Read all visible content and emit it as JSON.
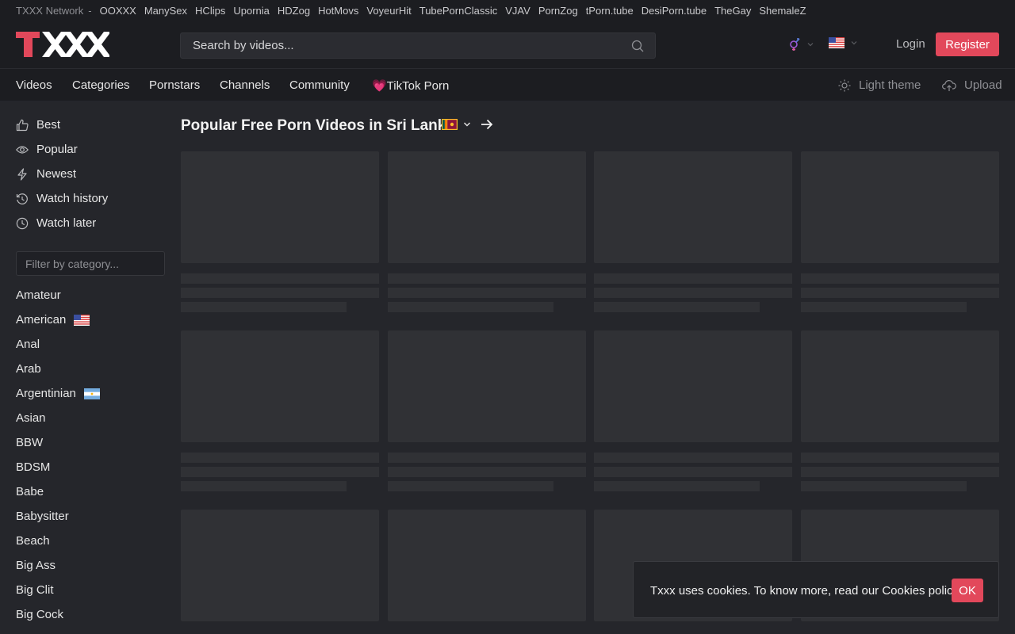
{
  "network": {
    "title": "TXXX Network",
    "separator": "-",
    "sites": [
      "OOXXX",
      "ManySex",
      "HClips",
      "Upornia",
      "HDZog",
      "HotMovs",
      "VoyeurHit",
      "TubePornClassic",
      "VJAV",
      "PornZog",
      "tPorn.tube",
      "DesiPorn.tube",
      "TheGay",
      "ShemaleZ"
    ]
  },
  "header": {
    "logo_text": "TXXX",
    "search_placeholder": "Search by videos...",
    "login_label": "Login",
    "register_label": "Register"
  },
  "nav": {
    "items": [
      "Videos",
      "Categories",
      "Pornstars",
      "Channels",
      "Community",
      "💗TikTok Porn"
    ],
    "light_theme_label": "Light theme",
    "upload_label": "Upload"
  },
  "sidebar": {
    "links": [
      {
        "label": "Best",
        "icon": "thumbs-up-icon"
      },
      {
        "label": "Popular",
        "icon": "eye-icon"
      },
      {
        "label": "Newest",
        "icon": "lightning-icon"
      },
      {
        "label": "Watch history",
        "icon": "history-icon"
      },
      {
        "label": "Watch later",
        "icon": "clock-icon"
      }
    ],
    "filter_placeholder": "Filter by category...",
    "categories": [
      "Amateur",
      "American",
      "Anal",
      "Arab",
      "Argentinian",
      "Asian",
      "BBW",
      "BDSM",
      "Babe",
      "Babysitter",
      "Beach",
      "Big Ass",
      "Big Clit",
      "Big Cock"
    ]
  },
  "main": {
    "title": "Popular Free Porn Videos in Sri Lanka"
  },
  "cookie": {
    "message": "Txxx uses cookies. To know more, read our Cookies policy.",
    "ok_label": "OK"
  },
  "colors": {
    "accent": "#e2485b",
    "background": "#1c1d21",
    "panel": "#25262b",
    "placeholder": "#303135"
  }
}
